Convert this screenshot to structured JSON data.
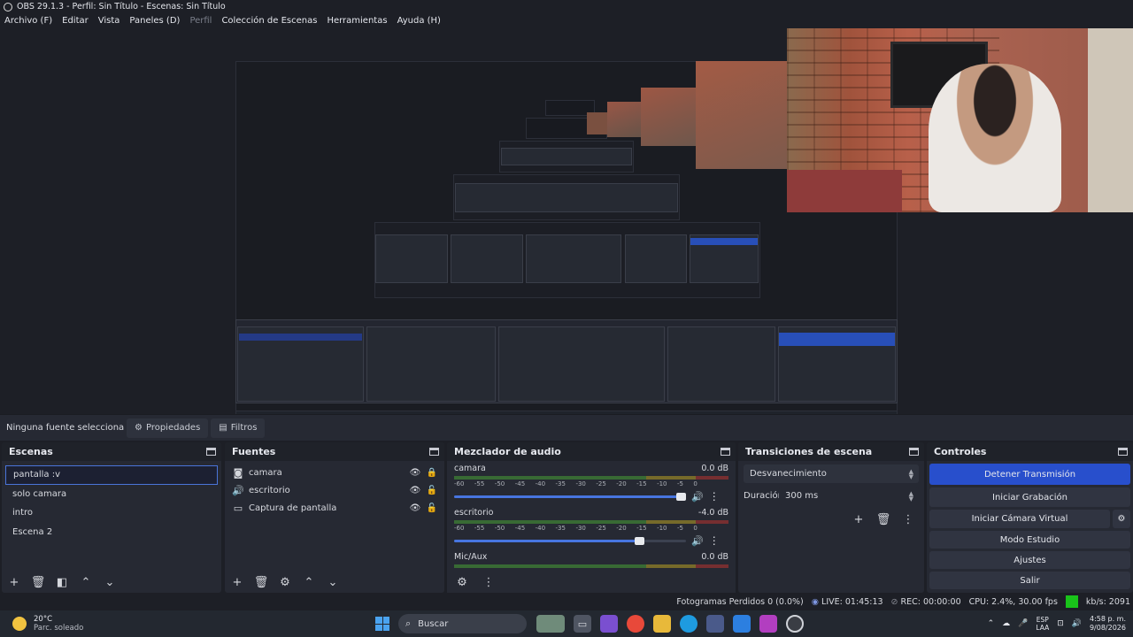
{
  "window": {
    "title": "OBS 29.1.3 - Perfil: Sin Título - Escenas: Sin Título"
  },
  "menu": {
    "items": [
      {
        "label": "Archivo (F)",
        "enabled": true
      },
      {
        "label": "Editar",
        "enabled": true
      },
      {
        "label": "Vista",
        "enabled": true
      },
      {
        "label": "Paneles (D)",
        "enabled": true
      },
      {
        "label": "Perfil",
        "enabled": false
      },
      {
        "label": "Colección de Escenas",
        "enabled": true
      },
      {
        "label": "Herramientas",
        "enabled": true
      },
      {
        "label": "Ayuda (H)",
        "enabled": true
      }
    ]
  },
  "context_bar": {
    "no_source_label": "Ninguna fuente seleccionac",
    "properties_label": "Propiedades",
    "filters_label": "Filtros"
  },
  "scenes": {
    "title": "Escenas",
    "items": [
      {
        "label": "pantalla :v",
        "selected": true
      },
      {
        "label": "solo camara",
        "selected": false
      },
      {
        "label": "intro",
        "selected": false
      },
      {
        "label": "Escena 2",
        "selected": false
      }
    ]
  },
  "sources": {
    "title": "Fuentes",
    "items": [
      {
        "label": "camara",
        "icon": "camera-icon",
        "visible": true,
        "locked": true
      },
      {
        "label": "escritorio",
        "icon": "speaker-icon",
        "visible": true,
        "locked": false
      },
      {
        "label": "Captura de pantalla",
        "icon": "monitor-icon",
        "visible": true,
        "locked": false
      }
    ]
  },
  "mixer": {
    "title": "Mezclador de audio",
    "ticks": [
      "-60",
      "-55",
      "-50",
      "-45",
      "-40",
      "-35",
      "-30",
      "-25",
      "-20",
      "-15",
      "-10",
      "-5",
      "0"
    ],
    "channels": [
      {
        "name": "camara",
        "level": "0.0 dB",
        "volume": 1.0
      },
      {
        "name": "escritorio",
        "level": "-4.0 dB",
        "volume": 0.82
      },
      {
        "name": "Mic/Aux",
        "level": "0.0 dB",
        "volume": 1.0
      }
    ]
  },
  "transitions": {
    "title": "Transiciones de escena",
    "selected": "Desvanecimiento",
    "duration_label": "Duración",
    "duration_value": "300 ms"
  },
  "controls": {
    "title": "Controles",
    "stop_stream": "Detener Transmisión",
    "start_recording": "Iniciar Grabación",
    "start_virtual_cam": "Iniciar Cámara Virtual",
    "studio_mode": "Modo Estudio",
    "settings": "Ajustes",
    "exit": "Salir"
  },
  "status": {
    "dropped_frames": "Fotogramas Perdidos 0 (0.0%)",
    "live": "LIVE: 01:45:13",
    "rec": "REC: 00:00:00",
    "cpu": "CPU: 2.4%, 30.00 fps",
    "kbps": "kb/s: 2091",
    "health_color": "#19c31a"
  },
  "taskbar": {
    "weather_temp": "20°C",
    "weather_desc": "Parc. soleado",
    "search_label": "Buscar",
    "lang_line1": "ESP",
    "lang_line2": "LAA",
    "time": "4:58 p. m.",
    "date": "9/08/2026"
  }
}
